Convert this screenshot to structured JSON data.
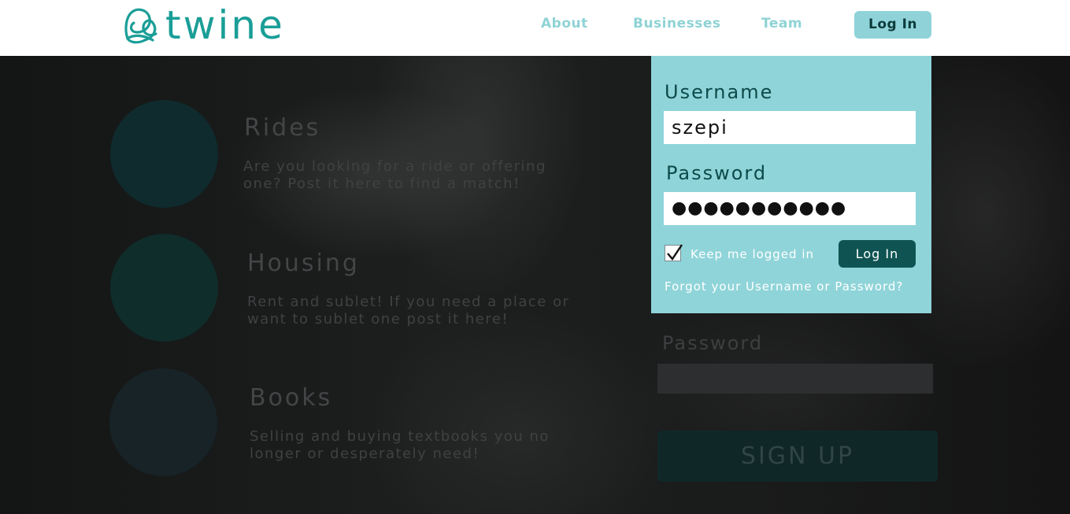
{
  "header": {
    "logo_text": "twine",
    "nav": {
      "about": "About",
      "businesses": "Businesses",
      "team": "Team"
    },
    "login_label": "Log In"
  },
  "features": [
    {
      "title": "Rides",
      "description": "Are you looking for a ride or offering one? Post it here to find a match!"
    },
    {
      "title": "Housing",
      "description": "Rent and sublet! If you need a place or want to sublet one post it here!"
    },
    {
      "title": "Books",
      "description": "Selling and buying textbooks you no longer or desperately need!"
    }
  ],
  "background_form": {
    "password_label": "Password",
    "signup_label": "SIGN UP"
  },
  "login_panel": {
    "username_label": "Username",
    "username_value": "szepi",
    "password_label": "Password",
    "password_value": "●●●●●●●●●●●",
    "keep_logged_in_label": "Keep me logged in",
    "keep_logged_in_checked": true,
    "login_button": "Log In",
    "forgot_link": "Forgot your Username or Password?"
  },
  "colors": {
    "brand_teal": "#1a9e97",
    "panel_bg": "#8fd4d9",
    "button_dark": "#0f5453"
  }
}
